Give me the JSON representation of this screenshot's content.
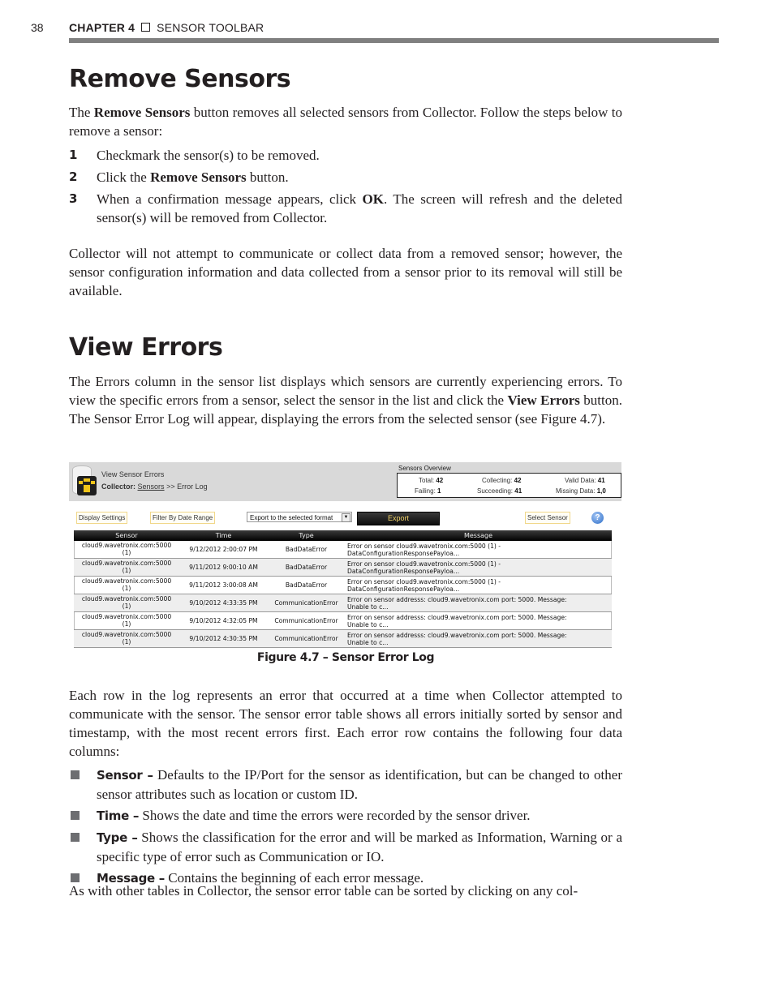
{
  "running_header": {
    "page_number": "38",
    "chapter_label": "CHAPTER 4",
    "chapter_title": "SENSOR TOOLBAR"
  },
  "remove_sensors": {
    "heading": "Remove Sensors",
    "intro_pre": "The ",
    "intro_bold": "Remove Sensors",
    "intro_post": " button removes all selected sensors from Collector. Follow the steps below to remove a sensor:",
    "steps": [
      {
        "num": "1",
        "pre": "Checkmark the sensor(s) to be removed.",
        "bold": "",
        "post": ""
      },
      {
        "num": "2",
        "pre": "Click the ",
        "bold": "Remove Sensors",
        "post": " button."
      },
      {
        "num": "3",
        "pre": "When a confirmation message appears, click ",
        "bold": "OK",
        "post": ". The screen will refresh and the deleted sensor(s) will be removed from Collector."
      }
    ],
    "note": "Collector will not attempt to communicate or collect data from a removed sensor; however, the sensor configuration information and data collected from a sensor prior to its removal will still be available."
  },
  "view_errors": {
    "heading": "View Errors",
    "intro_pre": "The Errors column in the sensor list displays which sensors are currently experiencing errors. To view the specific errors from a sensor, select the sensor in the list and click the ",
    "intro_bold": "View Errors",
    "intro_post": " button. The Sensor Error Log will appear, displaying the errors from the selected sensor (see Figure 4.7)."
  },
  "figure": {
    "window_title": "View Sensor Errors",
    "breadcrumb_prefix": "Collector:",
    "breadcrumb_link": "Sensors",
    "breadcrumb_rest": ">> Error Log",
    "overview": {
      "title": "Sensors Overview",
      "total_label": "Total:",
      "total_value": "42",
      "collecting_label": "Collecting:",
      "collecting_value": "42",
      "valid_label": "Valid Data:",
      "valid_value": "41",
      "failing_label": "Failing:",
      "failing_value": "1",
      "succeeding_label": "Succeeding:",
      "succeeding_value": "41",
      "missing_label": "Missing Data:",
      "missing_value": "1,0"
    },
    "toolbar": {
      "display_settings": "Display Settings",
      "filter_by_date": "Filter By Date Range",
      "export_format_selected": "Export to the selected format",
      "export": "Export",
      "select_sensor": "Select Sensor",
      "help": "?"
    },
    "table": {
      "columns": [
        "Sensor",
        "Time",
        "Type",
        "Message"
      ],
      "rows": [
        {
          "sensor": "cloud9.wavetronix.com:5000",
          "sensor_sub": "(1)",
          "time": "9/12/2012 2:00:07 PM",
          "type": "BadDataError",
          "message_1": "Error on sensor cloud9.wavetronix.com:5000 (1) -",
          "message_2": "DataConfigurationResponsePayloa..."
        },
        {
          "sensor": "cloud9.wavetronix.com:5000",
          "sensor_sub": "(1)",
          "time": "9/11/2012 9:00:10 AM",
          "type": "BadDataError",
          "message_1": "Error on sensor cloud9.wavetronix.com:5000 (1) -",
          "message_2": "DataConfigurationResponsePayloa..."
        },
        {
          "sensor": "cloud9.wavetronix.com:5000",
          "sensor_sub": "(1)",
          "time": "9/11/2012 3:00:08 AM",
          "type": "BadDataError",
          "message_1": "Error on sensor cloud9.wavetronix.com:5000 (1) -",
          "message_2": "DataConfigurationResponsePayloa..."
        },
        {
          "sensor": "cloud9.wavetronix.com:5000",
          "sensor_sub": "(1)",
          "time": "9/10/2012 4:33:35 PM",
          "type": "CommunicationError",
          "message_1": "Error on sensor addresss: cloud9.wavetronix.com port: 5000. Message:",
          "message_2": "Unable to c..."
        },
        {
          "sensor": "cloud9.wavetronix.com:5000",
          "sensor_sub": "(1)",
          "time": "9/10/2012 4:32:05 PM",
          "type": "CommunicationError",
          "message_1": "Error on sensor addresss: cloud9.wavetronix.com port: 5000. Message:",
          "message_2": "Unable to c..."
        },
        {
          "sensor": "cloud9.wavetronix.com:5000",
          "sensor_sub": "(1)",
          "time": "9/10/2012 4:30:35 PM",
          "type": "CommunicationError",
          "message_1": "Error on sensor addresss: cloud9.wavetronix.com port: 5000. Message:",
          "message_2": "Unable to c..."
        }
      ]
    },
    "caption": "Figure 4.7 – Sensor Error Log"
  },
  "error_log_description": {
    "para": "Each row in the log represents an error that occurred at a time when Collector attempted to communicate with the sensor. The sensor error table shows all errors initially sorted by sensor and timestamp, with the most recent errors first. Each error row contains the following four data columns:",
    "bullets": [
      {
        "term": "Sensor –",
        "text": " Defaults to the IP/Port for the sensor as identification, but can be changed to other sensor attributes such as location or custom ID."
      },
      {
        "term": "Time –",
        "text": " Shows the date and time the errors were recorded by the sensor driver."
      },
      {
        "term": "Type –",
        "text": " Shows the classification for the error and will be marked as Information, Warning or a specific type of error such as Communication or IO."
      },
      {
        "term": "Message –",
        "text": " Contains the beginning of each error message."
      }
    ],
    "closing": "As with other tables in Collector, the sensor error table can be sorted by clicking on any col-"
  }
}
